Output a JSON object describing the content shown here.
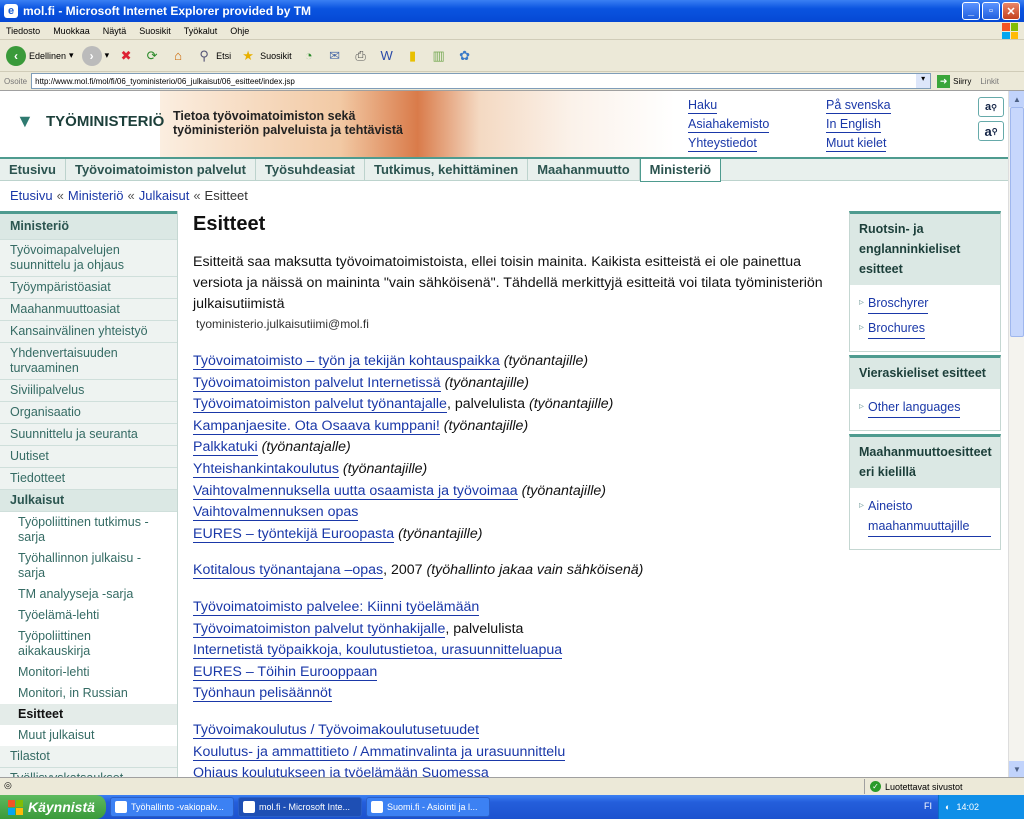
{
  "window": {
    "title": "mol.fi - Microsoft Internet Explorer provided by TM"
  },
  "menu": [
    "Tiedosto",
    "Muokkaa",
    "Näytä",
    "Suosikit",
    "Työkalut",
    "Ohje"
  ],
  "toolbar": {
    "back_label": "Edellinen",
    "search_label": "Etsi",
    "favorites_label": "Suosikit"
  },
  "address": {
    "label": "Osoite",
    "url": "http://www.mol.fi/mol/fi/06_tyoministerio/06_julkaisut/06_esitteet/index.jsp",
    "go_label": "Siirry",
    "links_label": "Linkit"
  },
  "site": {
    "logo_text": "TYÖMINISTERIÖ",
    "tagline_line1": "Tietoa työvoimatoimiston sekä",
    "tagline_line2": "työministeriön palveluista ja tehtävistä",
    "header_links": [
      "Haku",
      "På svenska",
      "Asiahakemisto",
      "In English",
      "Yhteystiedot",
      "Muut kielet"
    ],
    "font_buttons": [
      "a",
      "a"
    ]
  },
  "nav": {
    "tabs": [
      "Etusivu",
      "Työvoimatoimiston palvelut",
      "Työsuhdeasiat",
      "Tutkimus, kehittäminen",
      "Maahanmuutto",
      "Ministeriö"
    ],
    "active_index": 5
  },
  "breadcrumb": {
    "items": [
      "Etusivu",
      "Ministeriö",
      "Julkaisut"
    ],
    "current": "Esitteet",
    "separator": "«"
  },
  "sidebar": {
    "heading": "Ministeriö",
    "items": [
      "Työvoimapalvelujen suunnittelu ja ohjaus",
      "Työympäristöasiat",
      "Maahanmuuttoasiat",
      "Kansainvälinen yhteistyö",
      "Yhdenvertaisuuden turvaaminen",
      "Siviilipalvelus",
      "Organisaatio",
      "Suunnittelu ja seuranta",
      "Uutiset",
      "Tiedotteet"
    ],
    "section": "Julkaisut",
    "sub_items": [
      "Työpoliittinen tutkimus -sarja",
      "Työhallinnon julkaisu -sarja",
      "TM analyyseja -sarja",
      "Työelämä-lehti",
      "Työpoliittinen aikakauskirja",
      "Monitori-lehti",
      "Monitori, in Russian",
      "Esitteet",
      "Muut julkaisut"
    ],
    "sub_active_index": 7,
    "after_items": [
      "Tilastot",
      "Työllisyyskatsaukset"
    ]
  },
  "content": {
    "title": "Esitteet",
    "intro": "Esitteitä saa maksutta työvoimatoimistoista, ellei toisin mainita. Kaikista esitteistä ei ole painettua versiota ja näissä on maininta \"vain sähköisenä\". Tähdellä merkittyjä esitteitä voi tilata työministeriön julkaisutiimistä",
    "email": "tyoministerio.julkaisutiimi@mol.fi",
    "group1": [
      {
        "link": "Työvoimatoimisto – työn ja tekijän kohtauspaikka",
        "plain": "",
        "note": "(työnantajille)"
      },
      {
        "link": "Työvoimatoimiston palvelut Internetissä",
        "plain": "",
        "note": "(työnantajille)"
      },
      {
        "link": "Työvoimatoimiston palvelut työnantajalle",
        "plain": ", palvelulista",
        "note": "(työnantajille)"
      },
      {
        "link": "Kampanjaesite. Ota Osaava kumppani!",
        "plain": "",
        "note": "(työnantajille)"
      },
      {
        "link": "Palkkatuki",
        "plain": "",
        "note": "(työnantajalle)"
      },
      {
        "link": "Yhteishankintakoulutus",
        "plain": "",
        "note": "(työnantajille)"
      },
      {
        "link": "Vaihtovalmennuksella uutta osaamista ja työvoimaa",
        "plain": "",
        "note": "(työnantajille)"
      },
      {
        "link": "Vaihtovalmennuksen opas",
        "plain": "",
        "note": ""
      },
      {
        "link": "EURES – työntekijä Euroopasta",
        "plain": "",
        "note": "(työnantajille)"
      }
    ],
    "group2": [
      {
        "link": "Kotitalous työnantajana –opas",
        "plain": ", 2007",
        "note": "(työhallinto jakaa vain sähköisenä)"
      }
    ],
    "group3": [
      {
        "link": "Työvoimatoimisto palvelee: Kiinni työelämään",
        "plain": "",
        "note": ""
      },
      {
        "link": "Työvoimatoimiston palvelut työnhakijalle",
        "plain": ", palvelulista",
        "note": ""
      },
      {
        "link": "Internetistä työpaikkoja, koulutustietoa, urasuunnitteluapua",
        "plain": "",
        "note": ""
      },
      {
        "link": "EURES – Töihin Eurooppaan",
        "plain": "",
        "note": ""
      },
      {
        "link": "Työnhaun pelisäännöt",
        "plain": "",
        "note": ""
      }
    ],
    "group4": [
      {
        "link": "Työvoimakoulutus / Työvoimakoulutusetuudet",
        "plain": "",
        "note": ""
      },
      {
        "link": "Koulutus- ja ammattitieto / Ammatinvalinta ja urasuunnittelu",
        "plain": "",
        "note": ""
      },
      {
        "link": "Ohjaus koulutukseen ja työelämään Suomessa",
        "plain": "",
        "note": ""
      }
    ]
  },
  "right": {
    "box1": {
      "title": "Ruotsin- ja englanninkieliset esitteet",
      "links": [
        "Broschyrer",
        "Brochures"
      ]
    },
    "box2": {
      "title": "Vieraskieliset esitteet",
      "links": [
        "Other languages"
      ]
    },
    "box3": {
      "title": "Maahanmuuttoesitteet eri kielillä",
      "links": [
        "Aineisto maahanmuuttajille"
      ]
    }
  },
  "status": {
    "zone": "Luotettavat sivustot"
  },
  "taskbar": {
    "start": "Käynnistä",
    "tasks": [
      "Työhallinto -vakiopalv...",
      "mol.fi - Microsoft Inte...",
      "Suomi.fi - Asiointi ja l..."
    ],
    "active_task": 1,
    "lang": "FI",
    "clock": "14:02"
  }
}
